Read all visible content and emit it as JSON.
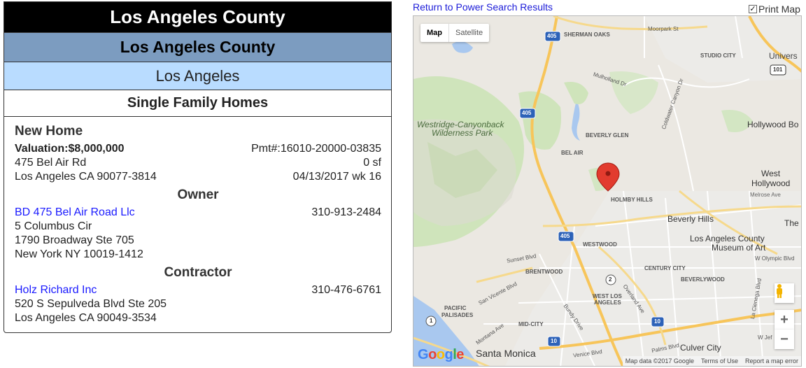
{
  "headers": {
    "county_top": "Los Angeles County",
    "county": "Los Angeles County",
    "city": "Los Angeles",
    "category": "Single Family Homes"
  },
  "permit": {
    "type": "New Home",
    "valuation": "Valuation:$8,000,000",
    "permit_number": "Pmt#:16010-20000-03835",
    "address1": "475 Bel Air Rd",
    "square_feet": "0 sf",
    "address2": "Los Angeles CA 90077-3814",
    "date_week": "04/13/2017 wk 16"
  },
  "owner": {
    "section_title": "Owner",
    "name": "BD 475 Bel Air Road Llc",
    "phone": "310-913-2484",
    "line1": "5 Columbus Cir",
    "line2": "1790 Broadway Ste 705",
    "line3": "New York NY 10019-1412"
  },
  "contractor": {
    "section_title": "Contractor",
    "name": "Holz Richard Inc",
    "phone": "310-476-6761",
    "line1": "520 S Sepulveda Blvd Ste 205",
    "line2": "Los Angeles CA 90049-3534"
  },
  "map_header": {
    "return_link": "Return to Power Search Results",
    "print_map": "Print Map",
    "print_checked": true
  },
  "map": {
    "type_map": "Map",
    "type_satellite": "Satellite",
    "zoom_in": "+",
    "zoom_out": "−",
    "google": "Google",
    "attribution": {
      "data": "Map data ©2017 Google",
      "terms": "Terms of Use",
      "report": "Report a map error"
    },
    "labels": {
      "sherman_oaks": "SHERMAN OAKS",
      "moorpark": "Moorpark St",
      "universal": "Univers",
      "studio_city": "STUDIO CITY",
      "mulholland": "Mulholland Dr",
      "westridge1": "Westridge-Canyonback",
      "westridge2": "Wilderness Park",
      "coldwater": "Coldwater Canyon Dr",
      "hollywood_bowl": "Hollywood Bo",
      "beverly_glen": "BEVERLY GLEN",
      "bel_air": "BEL AIR",
      "west_hollywood1": "West",
      "west_hollywood2": "Hollywood",
      "melrose": "Melrose Ave",
      "holmby_hills": "HOLMBY HILLS",
      "beverly_hills": "Beverly Hills",
      "the": "The",
      "lacma1": "Los Angeles County",
      "lacma2": "Museum of Art",
      "westwood": "WESTWOOD",
      "sunset": "Sunset Blvd",
      "brentwood": "BRENTWOOD",
      "century_city": "CENTURY CITY",
      "olympic": "W Olympic Blvd",
      "beverlywood": "BEVERLYWOOD",
      "san_vicente": "San Vicente Blvd",
      "overland": "Overland Ave",
      "pacific_palisades1": "PACIFIC",
      "pacific_palisades2": "PALISADES",
      "west_la1": "WEST LOS",
      "west_la2": "ANGELES",
      "bundy": "Bundy Drive",
      "montana": "Montana Ave",
      "mid_city": "MID-CITY",
      "santa_monica": "Santa Monica",
      "palms": "Palms Blvd",
      "culver_city": "Culver City",
      "w_jeff": "W Jef",
      "venice": "Venice Blvd",
      "la_cienega": "La Cienega Blvd",
      "hwy_405a": "405",
      "hwy_405b": "405",
      "hwy_405c": "405",
      "hwy_101": "101",
      "hwy_10a": "10",
      "hwy_10b": "10",
      "hwy_2": "2",
      "hwy_1": "1"
    }
  }
}
